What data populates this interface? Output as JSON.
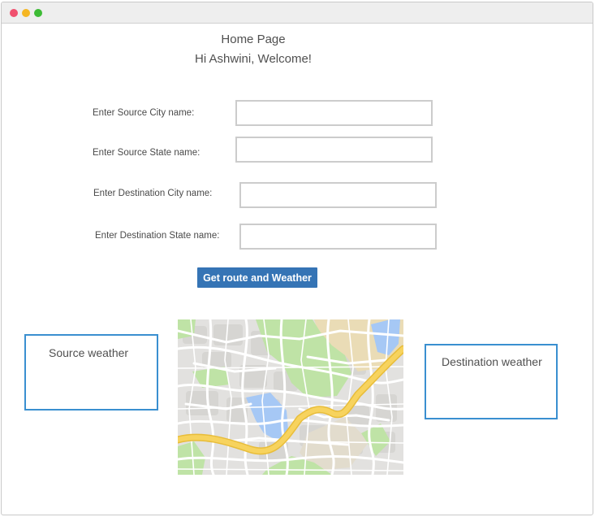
{
  "window": {
    "controls": [
      "close",
      "minimize",
      "maximize"
    ]
  },
  "page": {
    "title": "Home Page",
    "greeting": "Hi Ashwini, Welcome!"
  },
  "form": {
    "source_city_label": "Enter Source City name:",
    "source_city_value": "",
    "source_state_label": "Enter Source State name:",
    "source_state_value": "",
    "dest_city_label": "Enter Destination City name:",
    "dest_city_value": "",
    "dest_state_label": "Enter Destination State name:",
    "dest_state_value": "",
    "submit_label": "Get route and Weather"
  },
  "weather": {
    "source_title": "Source weather",
    "destination_title": "Destination weather"
  },
  "colors": {
    "accent": "#3574b5",
    "box_border": "#3a8fd0",
    "route": "#f7d35e",
    "park": "#bfe3a6",
    "water": "#a6c8f5"
  }
}
